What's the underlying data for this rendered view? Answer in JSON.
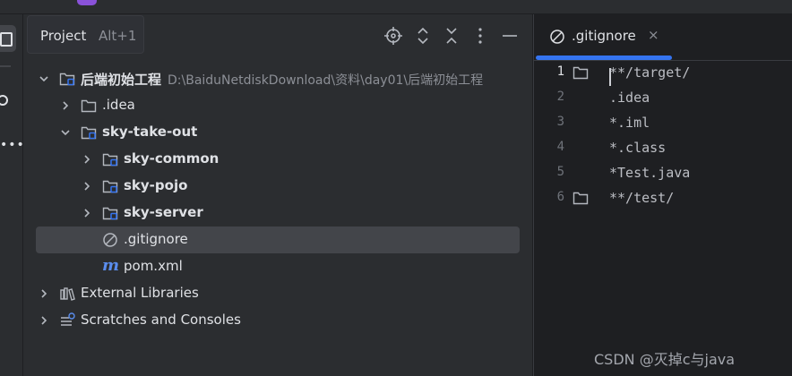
{
  "project_panel": {
    "tab_title": "Project",
    "tab_shortcut": "Alt+1"
  },
  "tree": [
    {
      "label": "后端初始工程",
      "path": "D:\\BaiduNetdiskDownload\\资料\\day01\\后端初始工程",
      "icon": "module-folder-icon",
      "expanded": true,
      "bold": true
    },
    {
      "label": ".idea",
      "icon": "folder-icon",
      "expanded": false,
      "bold": false
    },
    {
      "label": "sky-take-out",
      "icon": "module-folder-icon",
      "expanded": true,
      "bold": true
    },
    {
      "label": "sky-common",
      "icon": "module-folder-icon",
      "expanded": false,
      "bold": true
    },
    {
      "label": "sky-pojo",
      "icon": "module-folder-icon",
      "expanded": false,
      "bold": true
    },
    {
      "label": "sky-server",
      "icon": "module-folder-icon",
      "expanded": false,
      "bold": true
    },
    {
      "label": ".gitignore",
      "icon": "ignore-file-icon",
      "selected": true
    },
    {
      "label": "pom.xml",
      "icon": "maven-icon"
    },
    {
      "label": "External Libraries",
      "icon": "library-icon",
      "expanded": false
    },
    {
      "label": "Scratches and Consoles",
      "icon": "scratches-icon",
      "expanded": false
    }
  ],
  "editor": {
    "tab_name": ".gitignore",
    "close_glyph": "×",
    "line_numbers": [
      "1",
      "2",
      "3",
      "4",
      "5",
      "6"
    ],
    "lines": [
      "**/target/",
      ".idea",
      "*.iml",
      "*.class",
      "*Test.java",
      "**/test/"
    ]
  },
  "watermark": "CSDN @灭掉c与java",
  "colors": {
    "background": "#1e1f22",
    "panel": "#2b2d30",
    "selection": "#43454a",
    "accent": "#3574f0",
    "module_badge": "#3574f0",
    "maven": "#5a8dee"
  }
}
